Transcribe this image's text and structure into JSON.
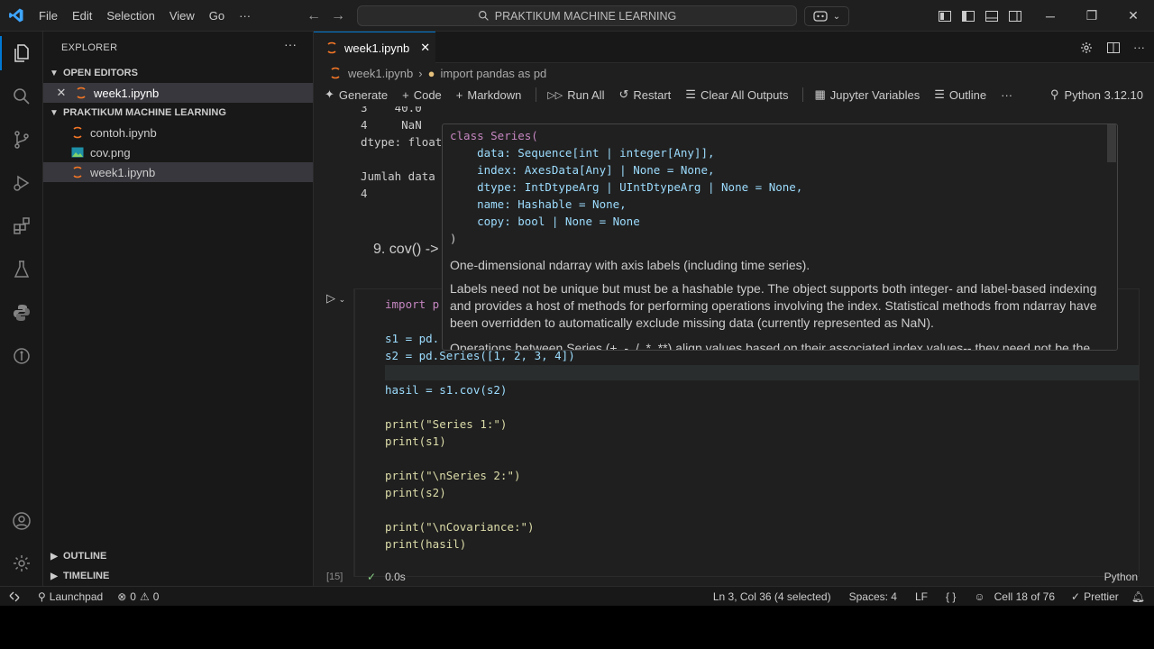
{
  "titlebar": {
    "menus": [
      "File",
      "Edit",
      "Selection",
      "View",
      "Go",
      "···"
    ],
    "command_center": "PRAKTIKUM MACHINE LEARNING"
  },
  "sidebar": {
    "title": "EXPLORER",
    "more": "···",
    "open_editors_label": "OPEN EDITORS",
    "open_editors": [
      {
        "name": "week1.ipynb"
      }
    ],
    "folder_label": "PRAKTIKUM MACHINE LEARNING",
    "files": [
      {
        "name": "contoh.ipynb"
      },
      {
        "name": "cov.png"
      },
      {
        "name": "week1.ipynb"
      }
    ],
    "outline_label": "OUTLINE",
    "timeline_label": "TIMELINE"
  },
  "editor": {
    "tab_label": "week1.ipynb",
    "breadcrumb_file": "week1.ipynb",
    "breadcrumb_cell": "import pandas as pd",
    "toolbar": {
      "generate": "Generate",
      "code": "Code",
      "markdown": "Markdown",
      "run_all": "Run All",
      "restart": "Restart",
      "clear_outputs": "Clear All Outputs",
      "variables": "Jupyter Variables",
      "outline": "Outline",
      "more": "···",
      "kernel": "Python 3.12.10"
    },
    "output_lines": [
      "3    40.0",
      "4     NaN",
      "dtype: float",
      "",
      "Jumlah data",
      "4"
    ],
    "markdown_heading": "9. cov() ->",
    "code_lines": [
      "import p",
      "",
      "s1 = pd.",
      "s2 = pd.Series([1, 2, 3, 4])",
      "",
      "hasil = s1.cov(s2)",
      "",
      "print(\"Series 1:\")",
      "print(s1)",
      "",
      "print(\"\\nSeries 2:\")",
      "print(s2)",
      "",
      "print(\"\\nCovariance:\")",
      "print(hasil)"
    ],
    "exec_count": "[15]",
    "exec_time": "0.0s",
    "cell_language": "Python"
  },
  "hover": {
    "signature": [
      "class Series(",
      "    data: Sequence[int | integer[Any]],",
      "    index: AxesData[Any] | None = None,",
      "    dtype: IntDtypeArg | UIntDtypeArg | None = None,",
      "    name: Hashable = None,",
      "    copy: bool | None = None",
      ")"
    ],
    "desc1": "One-dimensional ndarray with axis labels (including time series).",
    "desc2": "Labels need not be unique but must be a hashable type. The object supports both integer- and label-based indexing and provides a host of methods for performing operations involving the index. Statistical methods from ndarray have been overridden to automatically exclude missing data (currently represented as NaN).",
    "desc3": "Operations between Series (+, -, /, *, **) align values based on their associated index values-- they need not be the"
  },
  "statusbar": {
    "launchpad": "Launchpad",
    "errors": "0",
    "warnings": "0",
    "cursor": "Ln 3, Col 36 (4 selected)",
    "spaces": "Spaces: 4",
    "eol": "LF",
    "braces": "{ }",
    "cell": "Cell 18 of 76",
    "prettier": "Prettier"
  },
  "colors": {
    "accent": "#0078d4",
    "editor_bg": "#1f1f1f",
    "sidebar_bg": "#181818",
    "selection": "#37373d"
  }
}
